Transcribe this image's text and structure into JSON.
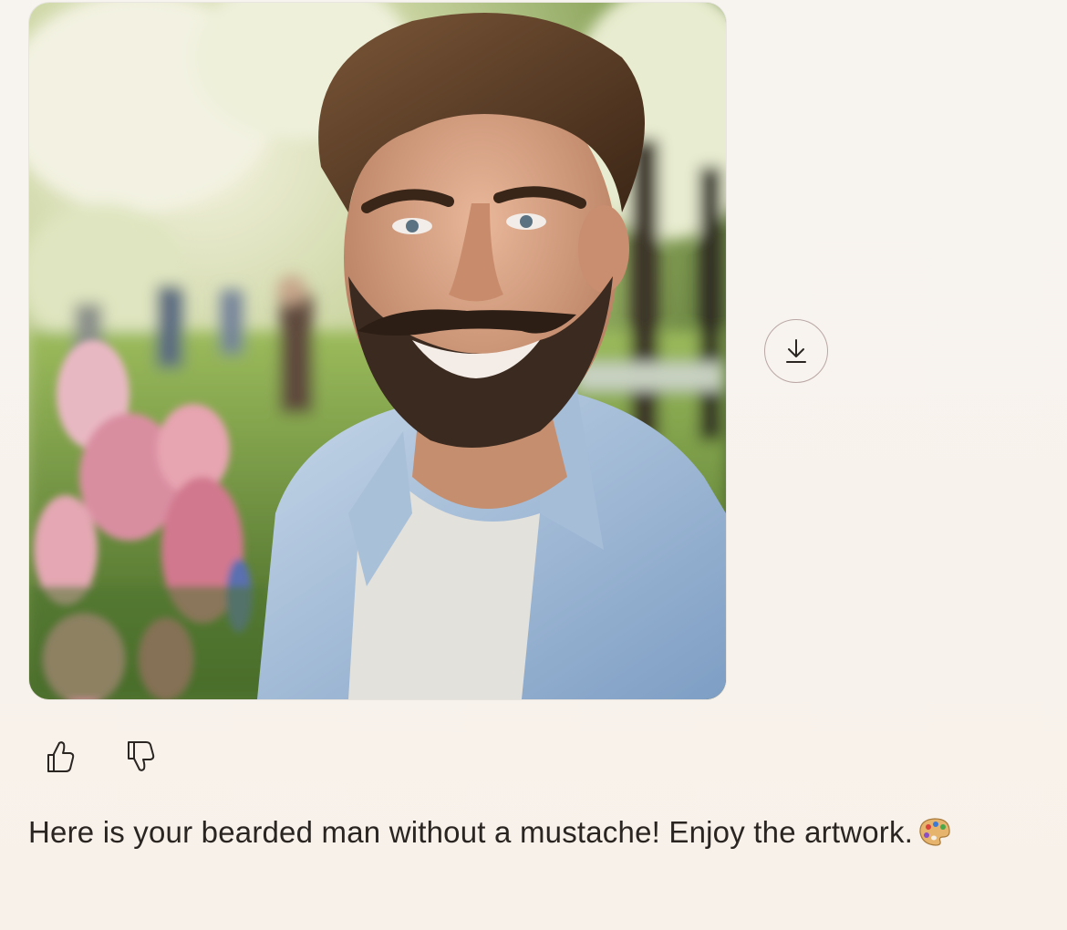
{
  "generated_image": {
    "alt": "Portrait of a smiling bearded man in a light blue denim shirt over a white t-shirt, standing in a sunny park with blossoming trees and pink flowers"
  },
  "actions": {
    "download_icon": "download-icon",
    "like_icon": "thumbs-up-icon",
    "dislike_icon": "thumbs-down-icon"
  },
  "message": {
    "text": "Here is your bearded man without a mustache! Enjoy the artwork.",
    "emoji_icon": "artist-palette-icon"
  },
  "colors": {
    "background": "#f8f3ee",
    "text": "#2b2522",
    "button_border": "#b9a7a5"
  }
}
